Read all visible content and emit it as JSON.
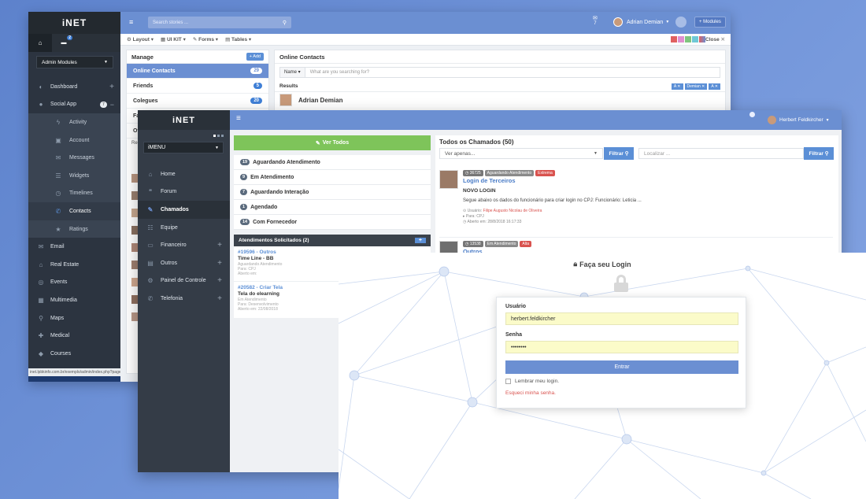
{
  "admin": {
    "logo": "iNET",
    "badge": "2",
    "modules_dropdown": "Admin Modules",
    "nav": [
      {
        "label": "Dashboard",
        "icon": "dashboard-icon"
      },
      {
        "label": "Social App",
        "icon": "user-icon",
        "badge": "7"
      }
    ],
    "social_sub": [
      "Activity",
      "Account",
      "Messages",
      "Widgets",
      "Timelines",
      "Contacts",
      "Ratings"
    ],
    "nav2": [
      "Email",
      "Real Estate",
      "Events",
      "Multimedia",
      "Maps",
      "Medical",
      "Courses"
    ],
    "search_placeholder": "Search stories ...",
    "notif_count": "7",
    "user_name": "Adrian Demian",
    "modules_btn": "+ Modules",
    "breadcrumbs": [
      "Layout",
      "UI KIT",
      "Forms",
      "Tables"
    ],
    "close_label": "Close",
    "manage_title": "Manage",
    "add_btn": "+ Add",
    "manage_items": [
      {
        "label": "Online Contacts",
        "count": "29"
      },
      {
        "label": "Friends",
        "count": "5"
      },
      {
        "label": "Colegues",
        "count": "20"
      },
      {
        "label": "Fa",
        "count": ""
      },
      {
        "label": "Ot",
        "count": ""
      }
    ],
    "rec_label": "Rec",
    "online_contacts_title": "Online Contacts",
    "name_filter": "Name",
    "search2_placeholder": "What are you searching for?",
    "results_label": "Results",
    "result_tags": [
      "A",
      "Demian",
      "A"
    ],
    "contact_name": "Adrian Demian",
    "status_url": "inet.lpbkinfo.com.br/exemplo/admin/index.php?pageid"
  },
  "helpdesk": {
    "logo": "iNET",
    "menu_dropdown": "iMENU",
    "nav": [
      {
        "label": "Home",
        "icon": "home-icon"
      },
      {
        "label": "Forum",
        "icon": "forum-icon"
      },
      {
        "label": "Chamados",
        "icon": "ticket-icon"
      },
      {
        "label": "Equipe",
        "icon": "team-icon"
      },
      {
        "label": "Financeiro",
        "icon": "money-icon"
      },
      {
        "label": "Outros",
        "icon": "folder-icon"
      },
      {
        "label": "Painel de Controle",
        "icon": "gears-icon"
      },
      {
        "label": "Telefonia",
        "icon": "phone-icon"
      }
    ],
    "user_name": "Herbert Feldkircher",
    "view_all_btn": "Ver Todos",
    "statuses": [
      {
        "count": "19",
        "label": "Aguardando Atendimento"
      },
      {
        "count": "9",
        "label": "Em Atendimento"
      },
      {
        "count": "7",
        "label": "Aguardando Interação"
      },
      {
        "count": "1",
        "label": "Agendado"
      },
      {
        "count": "14",
        "label": "Com Fornecedor"
      }
    ],
    "requested_title": "Atendimentos Solicitados (2)",
    "requests": [
      {
        "id": "#19596 - Outros",
        "title": "Time Line - BB",
        "status": "Aguardando Atendimento",
        "to": "Para: CPJ",
        "opened": "Aberto em:"
      },
      {
        "id": "#20582 - Criar Tela",
        "title": "Tela do elearning",
        "status": "Em Atendimento",
        "to": "Para: Desenvolvimento",
        "opened": "Aberto em: 22/08/2018"
      }
    ],
    "all_tickets_title": "Todos os Chamados (50)",
    "view_only_placeholder": "Ver apenas...",
    "filter_btn": "Filtrar",
    "locate_placeholder": "Localizar ...",
    "ticket1": {
      "num": "36725",
      "status": "Aguardando Atendimento",
      "priority": "Extrema",
      "title": "Login de Terceiros",
      "heading": "NOVO LOGIN",
      "body": "Segue abaixo os dados do funcionário para criar login no CPJ: Funcionário: Leticia ...",
      "user_prefix": "Usuário: ",
      "user": "Filipe Augusto Nicolau de Oliveira",
      "to": "Para: CPJ",
      "opened": "Aberto em: 28/8/2018 16:17:33"
    },
    "ticket2": {
      "num": "13538",
      "status": "Em Atendimento",
      "priority": "Alta",
      "title": "Outros"
    }
  },
  "login": {
    "title": "Faça seu Login",
    "user_label": "Usuário",
    "user_value": "herbert.feldkircher",
    "pass_label": "Senha",
    "pass_value": "••••••••",
    "submit": "Entrar",
    "remember": "Lembrar meu login.",
    "forgot": "Esqueci minha senha."
  },
  "colors": {
    "accent": "#6b8fd2",
    "sidebar": "#2c3440",
    "green": "#7ec45a",
    "danger": "#d9534f"
  }
}
